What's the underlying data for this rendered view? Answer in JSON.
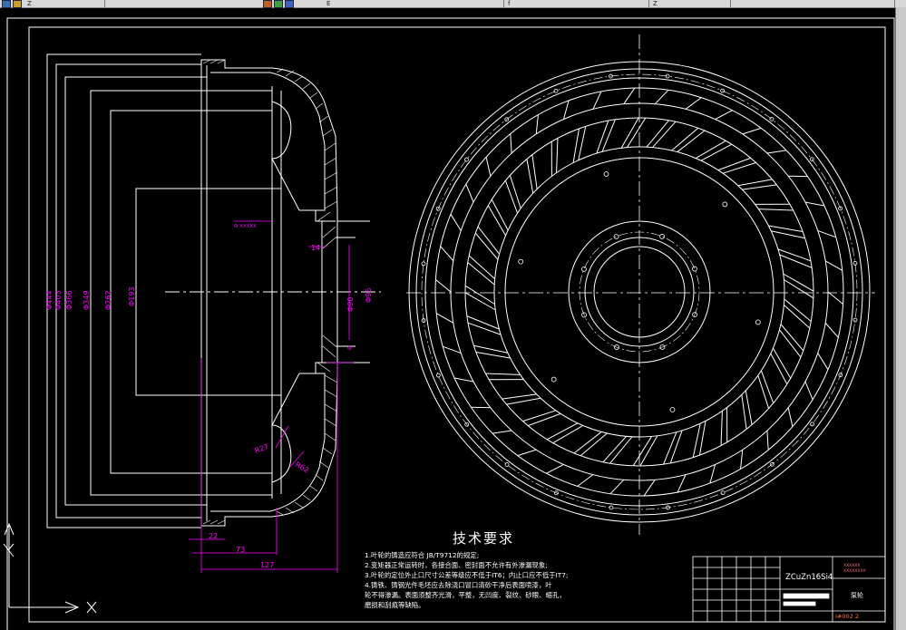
{
  "window": {
    "menu_fragments": [
      "Z",
      "E",
      "f",
      "Z"
    ]
  },
  "drawing": {
    "dimensions": {
      "d444": "Φ444",
      "d403": "Φ403",
      "d366": "Φ366",
      "d349": "Φ349",
      "d262": "Φ262",
      "d193": "Φ193",
      "d90": "Φ90",
      "d95": "Φ95",
      "r27": "R27",
      "r62": "R62",
      "w14": "14",
      "l22": "22",
      "l73": "73",
      "l127": "127",
      "tol_left": "Φ XXXXX",
      "tol_small": "Φ"
    },
    "tech_requirements": {
      "title": "技术要求",
      "lines": [
        "1.叶轮的铸造应符合 JB/T9712的规定;",
        "2.变矩器正常运转时，各接合面、密封面不允许有外渗漏现象;",
        "3.叶轮的定位外止口尺寸公差等级应不低于IT6；内止口应不低于IT7;",
        "4.铸铁、铸钢光件毛坯应去除浇口冒口清砂干净后表面喷漆，叶",
        "  轮不得渗漏。表面须整齐光滑，平整，无凹度、裂纹、砂眼、缩孔，",
        "  磨损和刮痕等缺陷。"
      ]
    },
    "title_block": {
      "material": "ZCuZn16Si4",
      "part_name": "泵轮",
      "company_line1": "XXXXXX",
      "company_line2": "XXXXXXXX",
      "drawing_no": "I#002 2"
    }
  },
  "colors": {
    "background": "#000000",
    "line": "#ffffff",
    "dimension": "#ff00ff",
    "accent": "#ff3300"
  },
  "icons": {
    "ucs": "ucs-axis-icon"
  }
}
